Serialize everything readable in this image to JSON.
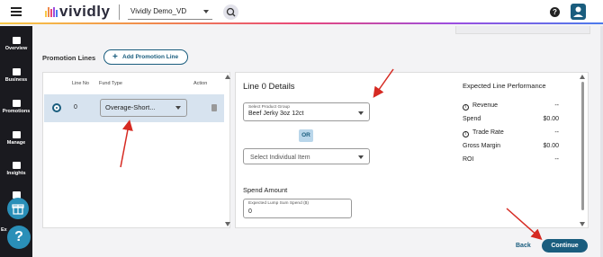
{
  "header": {
    "app_name": "vividly",
    "account": "Vividly Demo_VD",
    "help_glyph": "?",
    "brand_gradient": [
      "#f7c948",
      "#f08a4b",
      "#e8477a",
      "#9b4de0",
      "#4b7bec"
    ],
    "icons": [
      "menu-icon",
      "vividly-logo-icon",
      "chevron-down-icon",
      "search-icon",
      "help-icon",
      "user-icon"
    ]
  },
  "sidebar": {
    "items": [
      {
        "label": "Overview",
        "icon": "dashboard-icon"
      },
      {
        "label": "Business",
        "icon": "building-icon"
      },
      {
        "label": "Promotions",
        "icon": "tag-icon"
      },
      {
        "label": "Manage",
        "icon": "people-icon"
      },
      {
        "label": "Insights",
        "icon": "bar-chart-icon"
      },
      {
        "label": "In",
        "icon": "tools-icon"
      },
      {
        "label": "Ex",
        "icon": "export-icon"
      }
    ],
    "gift_icon": "gift-icon",
    "help_fab_glyph": "?"
  },
  "promotion_lines": {
    "title": "Promotion Lines",
    "add_button": "Add Promotion Line",
    "columns": [
      "Line No",
      "Fund Type",
      "Action"
    ],
    "rows": [
      {
        "line_no": "0",
        "fund_type": "Overage-Short...",
        "selected": true
      }
    ]
  },
  "details": {
    "title": "Line 0 Details",
    "product_group_label": "Select Product Group",
    "product_group_value": "Beef Jerky 3oz 12ct",
    "or_label": "OR",
    "individual_item_placeholder": "Select Individual Item",
    "spend_title": "Spend Amount",
    "lump_sum_label": "Expected Lump Sum Spend ($)",
    "lump_sum_value": "0"
  },
  "performance": {
    "title": "Expected Line Performance",
    "rows": [
      {
        "label": "Revenue",
        "value": "--",
        "info": true
      },
      {
        "label": "Spend",
        "value": "$0.00",
        "info": false
      },
      {
        "label": "Trade Rate",
        "value": "--",
        "info": true
      },
      {
        "label": "Gross Margin",
        "value": "$0.00",
        "info": false
      },
      {
        "label": "ROI",
        "value": "--",
        "info": false
      }
    ]
  },
  "footer": {
    "back": "Back",
    "continue": "Continue"
  },
  "colors": {
    "accent": "#1a5d7e",
    "selected_row": "#d7e3ef",
    "annotation": "#d62a22"
  }
}
